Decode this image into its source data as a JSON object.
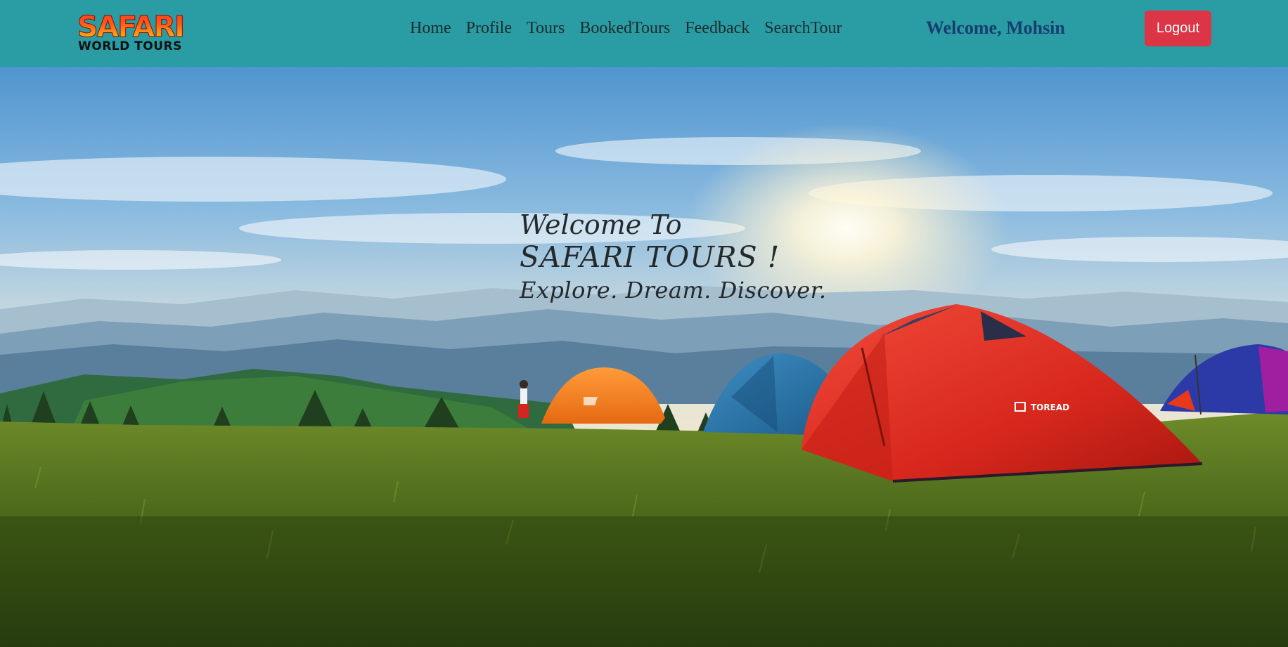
{
  "header": {
    "logo": {
      "line1": "SAFARI",
      "line2": "WORLD TOURS"
    },
    "nav": [
      {
        "label": "Home"
      },
      {
        "label": "Profile"
      },
      {
        "label": "Tours"
      },
      {
        "label": "BookedTours"
      },
      {
        "label": "Feedback"
      },
      {
        "label": "SearchTour"
      }
    ],
    "welcome": "Welcome, Mohsin",
    "logout_label": "Logout"
  },
  "hero": {
    "line1": "Welcome To",
    "line2": "SAFARI TOURS !",
    "line3": "Explore. Dream. Discover.",
    "tent_brand": "TOREAD"
  },
  "colors": {
    "navbar_bg": "#2a9ca4",
    "logout_bg": "#dc3545",
    "welcome_text": "#163e6e"
  }
}
